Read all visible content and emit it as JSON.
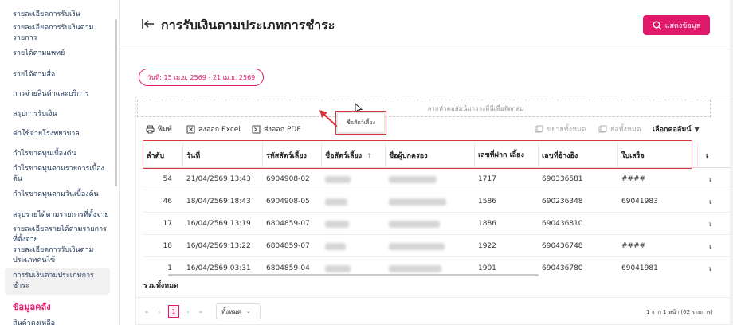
{
  "sidebar": {
    "items": [
      {
        "label": "รายละเอียดการรับเงิน"
      },
      {
        "label": "รายละเอียดการรับเงินตาม รายการ"
      },
      {
        "label": "รายได้ตามแพทย์"
      },
      {
        "label": "รายได้ตามสื่อ"
      },
      {
        "label": "การจ่ายสินค้าและบริการ"
      },
      {
        "label": "สรุปการรับเงิน"
      },
      {
        "label": "ค่าใช้จ่ายโรงพยาบาล"
      },
      {
        "label": "กำไรขาดทุนเบื้องต้น"
      },
      {
        "label": "กำไรขาดทุนตามรายการเบื้อง ต้น"
      },
      {
        "label": "กำไรขาดทุนตามวันเบื้องต้น"
      },
      {
        "label": "สรุปรายได้ตามรายการที่ตั้งจ่าย"
      },
      {
        "label": "รายละเอียดรายได้ตามรายการ ที่ตั้งจ่าย"
      },
      {
        "label": "รายละเอียดการรับเงินตาม ประเภทคนไข้"
      },
      {
        "label": "การรับเงินตามประเภทการชำระ"
      }
    ],
    "section_header": "ข้อมูลคลัง",
    "partial_item": "สินค้าคงเหลือ"
  },
  "header": {
    "title": "การรับเงินตามประเภทการชำระ",
    "show_button": "แสดงข้อมูล"
  },
  "date_filter": "วันที่: 15 เม.ย. 2569 - 21 เม.ย. 2569",
  "group_bar": {
    "placeholder": "ลากหัวคอลัมน์มาวางที่นี่เพื่อจัดกลุ่ม"
  },
  "drag_chip": "ชื่อสัตว์เลี้ยง",
  "toolbar": {
    "print": "พิมพ์",
    "export_excel": "ส่งออก Excel",
    "export_pdf": "ส่งออก PDF",
    "expand_all": "ขยายทั้งหมด",
    "collapse_all": "ย่อทั้งหมด",
    "choose_columns": "เลือกคอลัมน์"
  },
  "table": {
    "headers": [
      "ลำดับ",
      "วันที่",
      "รหัสสัตว์เลี้ยง",
      "ชื่อสัตว์เลี้ยง",
      "ชื่อผู้ปกครอง",
      "เลขที่ฝาก เลี้ยง",
      "เลขที่อ้างอิง",
      "ใบเสร็จ",
      "เ"
    ],
    "rows": [
      {
        "no": "54",
        "date": "21/04/2569 13:43",
        "pet_code": "6904908-02",
        "deposit_no": "1717",
        "ref_no": "690336581",
        "receipt": "####",
        "extra": "เ"
      },
      {
        "no": "46",
        "date": "18/04/2569 18:43",
        "pet_code": "6904908-05",
        "deposit_no": "1586",
        "ref_no": "690236348",
        "receipt": "69041983",
        "extra": "เ"
      },
      {
        "no": "17",
        "date": "16/04/2569 13:19",
        "pet_code": "6804859-07",
        "deposit_no": "1886",
        "ref_no": "690436810",
        "receipt": "",
        "extra": "เ"
      },
      {
        "no": "18",
        "date": "16/04/2569 13:22",
        "pet_code": "6804859-07",
        "deposit_no": "1922",
        "ref_no": "690436748",
        "receipt": "####",
        "extra": "เ"
      },
      {
        "no": "1",
        "date": "16/04/2569 03:31",
        "pet_code": "6804859-04",
        "deposit_no": "1901",
        "ref_no": "690436780",
        "receipt": "69041981",
        "extra": "เ"
      }
    ],
    "total_label": "รวมทั้งหมด"
  },
  "pagination": {
    "current_page": "1",
    "page_size": "ทั้งหมด",
    "info": "1 จาก 1 หน้า (62 รายการ)"
  },
  "colors": {
    "accent": "#e0196b",
    "highlight": "#d9363e"
  }
}
